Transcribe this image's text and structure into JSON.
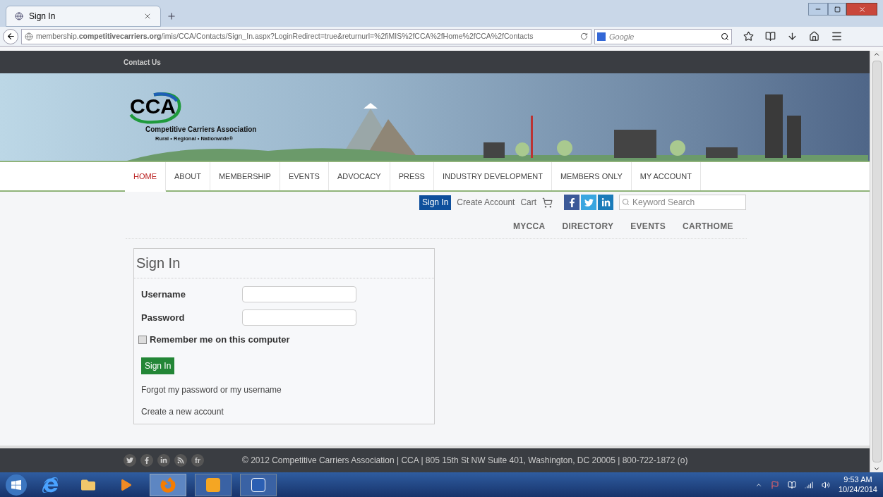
{
  "browser": {
    "tab_title": "Sign In",
    "url": "membership.**competitivecarriers.org**/imis/CCA/Contacts/Sign_In.aspx?LoginRedirect=true&returnurl=%2fiMIS%2fCCA%2fHome%2fCCA%2fContacts",
    "search_placeholder": "Google"
  },
  "top_bar": {
    "link": "Contact Us"
  },
  "logo": {
    "mark": "CCA",
    "name": "Competitive Carriers Association",
    "tagline": "Rural • Regional • Nationwide®"
  },
  "nav": [
    {
      "label": "HOME",
      "selected": true
    },
    {
      "label": "ABOUT",
      "selected": false
    },
    {
      "label": "MEMBERSHIP",
      "selected": false
    },
    {
      "label": "EVENTS",
      "selected": false
    },
    {
      "label": "ADVOCACY",
      "selected": false
    },
    {
      "label": "PRESS",
      "selected": false
    },
    {
      "label": "INDUSTRY DEVELOPMENT",
      "selected": false
    },
    {
      "label": "MEMBERS ONLY",
      "selected": false
    },
    {
      "label": "MY ACCOUNT",
      "selected": false
    }
  ],
  "utility": {
    "sign_in": "Sign In",
    "create_account": "Create Account",
    "cart": "Cart",
    "search_placeholder": "Keyword Search"
  },
  "sub_nav": [
    "MYCCA",
    "DIRECTORY",
    "EVENTS",
    "CARTHOME"
  ],
  "form": {
    "title": "Sign In",
    "username_label": "Username",
    "password_label": "Password",
    "remember": {
      "label": "Remember me on this computer",
      "checked": false
    },
    "submit": "Sign In",
    "links": [
      "Forgot my password or my username",
      "Create a new account"
    ]
  },
  "footer": {
    "social_text": "fr",
    "text": "© 2012 Competitive Carriers Association | CCA | 805 15th St NW Suite 401, Washington, DC 20005 | 800-722-1872 (o)"
  },
  "taskbar": {
    "time": "9:53 AM",
    "date": "10/24/2014"
  }
}
